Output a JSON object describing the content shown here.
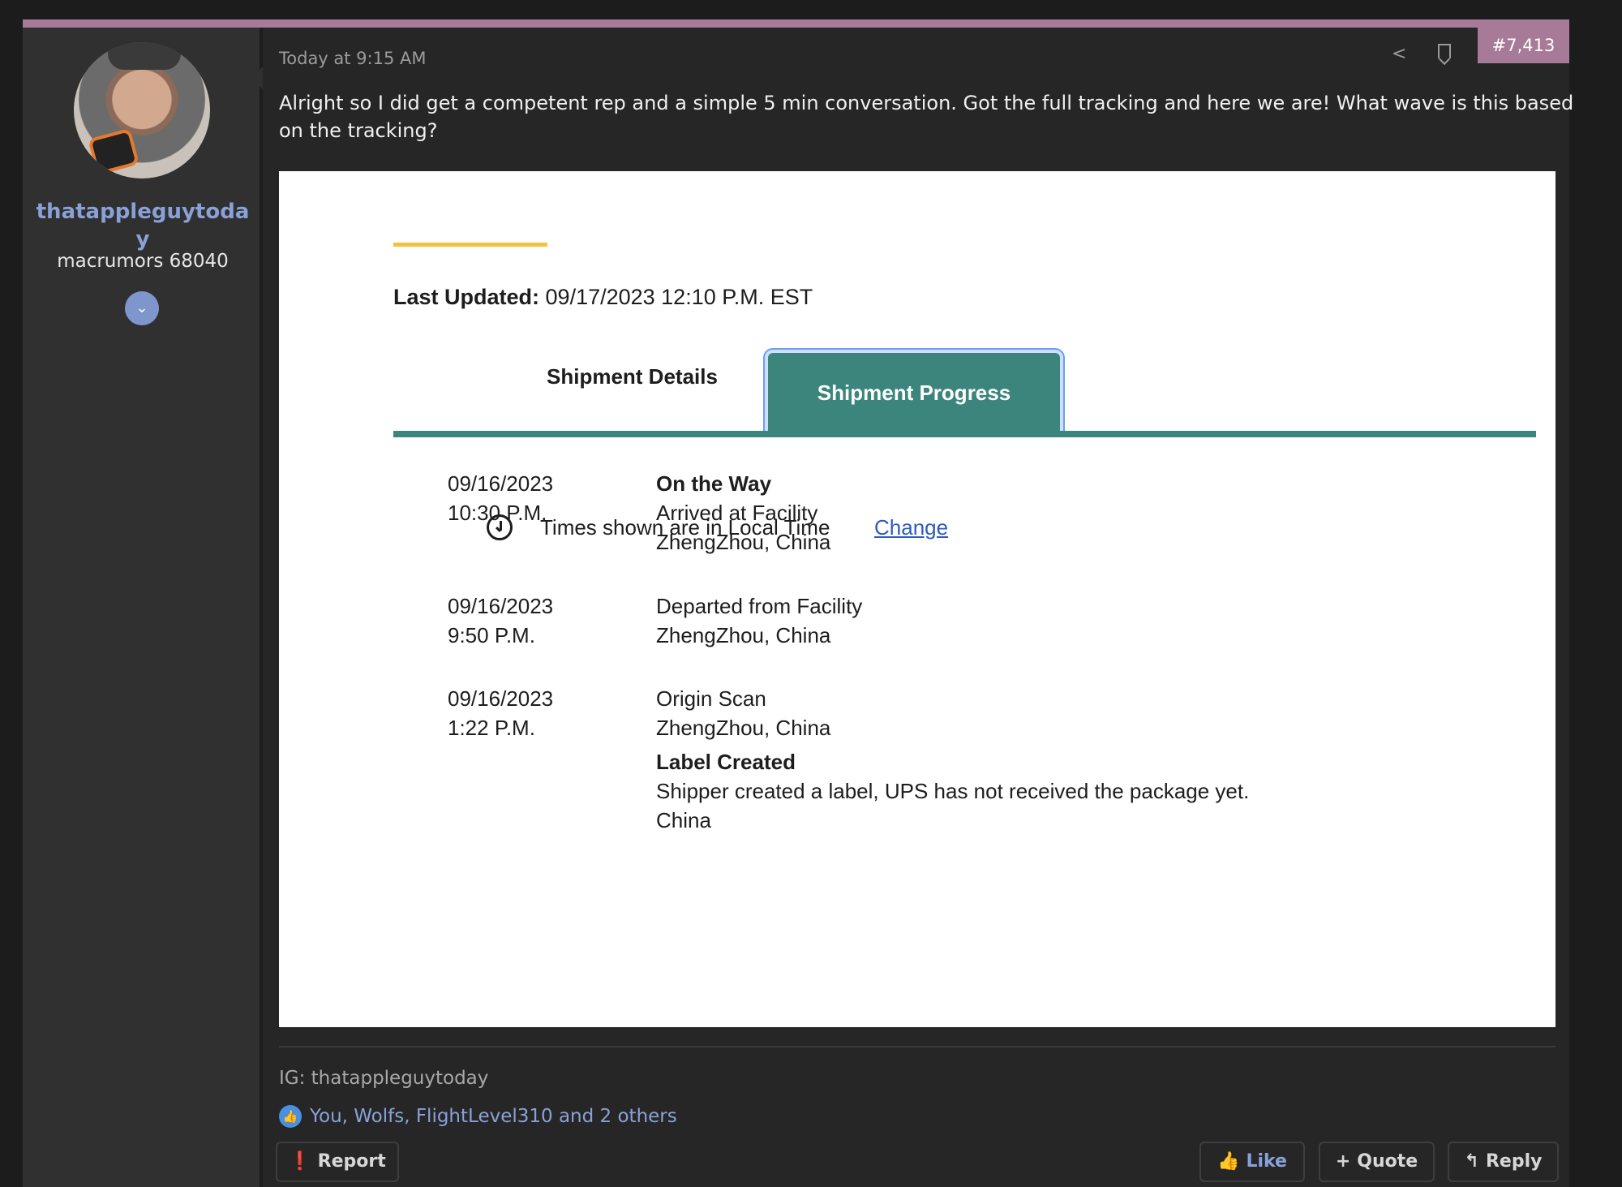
{
  "user": {
    "username": "thatappleguytoday",
    "title": "macrumors 68040",
    "expand_icon": "chevron-down-icon"
  },
  "post": {
    "timestamp": "Today at 9:15 AM",
    "number": "#7,413",
    "message": "Alright so I did get a competent rep and a simple 5 min conversation. Got the full tracking and here we are! What wave is this based on the tracking?",
    "signature": "IG: thatappleguytoday",
    "likes_text": "You, Wolfs, FlightLevel310 and 2 others"
  },
  "tracking": {
    "last_updated_label": "Last Updated:",
    "last_updated_value": "09/17/2023 12:10 P.M. EST",
    "tab_details": "Shipment Details",
    "tab_progress": "Shipment Progress",
    "times_note": "Times shown are in Local Time",
    "change_link": "Change",
    "events": [
      {
        "date": "09/16/2023",
        "time": "10:30 P.M.",
        "status": "On the Way",
        "line1": "Arrived at Facility",
        "line2": "ZhengZhou, China"
      },
      {
        "date": "09/16/2023",
        "time": "9:50 P.M.",
        "status": "",
        "line1": "Departed from Facility",
        "line2": "ZhengZhou, China"
      },
      {
        "date": "09/16/2023",
        "time": "1:22 P.M.",
        "status": "",
        "line1": "Origin Scan",
        "line2": "ZhengZhou, China"
      },
      {
        "date": "",
        "time": "",
        "status": "Label Created",
        "line1": "Shipper created a label, UPS has not received the package yet.",
        "line2": "China"
      }
    ]
  },
  "actions": {
    "report": "Report",
    "like": "Like",
    "quote": "Quote",
    "reply": "Reply"
  },
  "colors": {
    "accent": "#a77b97",
    "username": "#8aa1d8",
    "tab_active": "#3b857d",
    "tracking_accent": "#f3c241",
    "link": "#2d5bbd"
  }
}
